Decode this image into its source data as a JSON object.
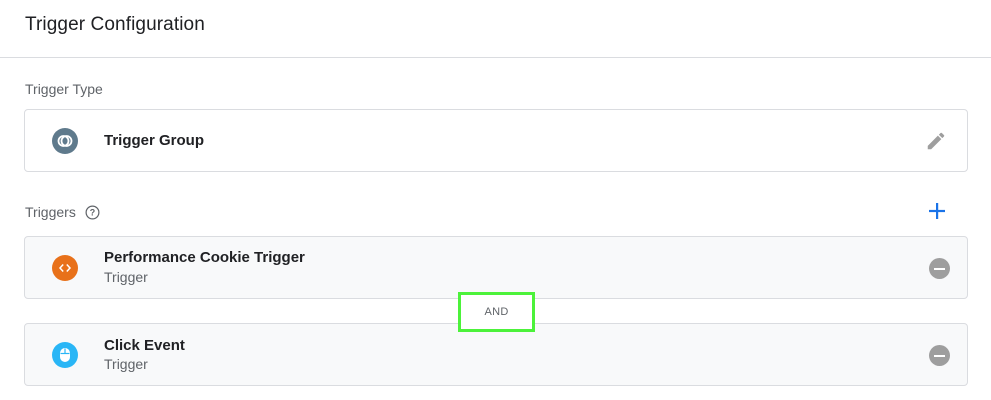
{
  "header": {
    "title": "Trigger Configuration"
  },
  "trigger_type": {
    "label": "Trigger Type",
    "name": "Trigger Group",
    "icon": "trigger-group-icon",
    "icon_color": "#5f7a8c"
  },
  "triggers": {
    "label": "Triggers",
    "accent_color": "#1a73e8",
    "items": [
      {
        "title": "Performance Cookie Trigger",
        "subtitle": "Trigger",
        "icon": "custom-code-icon",
        "icon_color": "#e8711a"
      },
      {
        "title": "Click Event",
        "subtitle": "Trigger",
        "icon": "mouse-click-icon",
        "icon_color": "#29b6f6"
      }
    ],
    "connector": "AND"
  }
}
